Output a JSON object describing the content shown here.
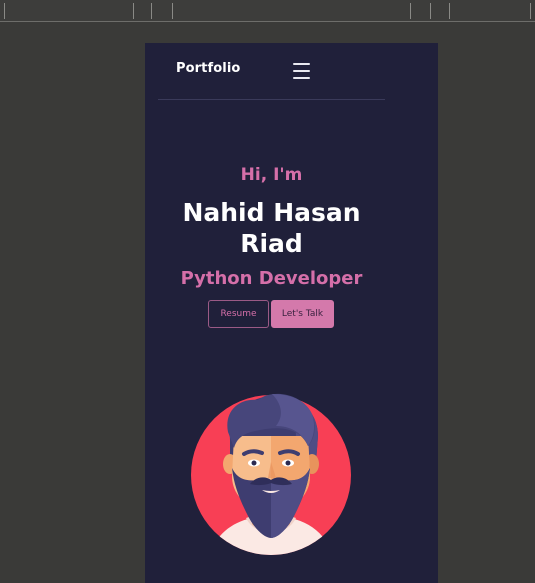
{
  "nav": {
    "brand": "Portfolio",
    "menu_icon": "hamburger-menu-icon"
  },
  "hero": {
    "greeting": "Hi, I'm",
    "name_line1": "Nahid Hasan",
    "name_line2": "Riad",
    "role": "Python Developer",
    "resume_label": "Resume",
    "talk_label": "Let's Talk"
  },
  "avatar": {
    "icon": "bearded-man-avatar-icon"
  },
  "colors": {
    "page_bg": "#20203a",
    "accent": "#d56fa9",
    "avatar_circle": "#f83f55"
  }
}
